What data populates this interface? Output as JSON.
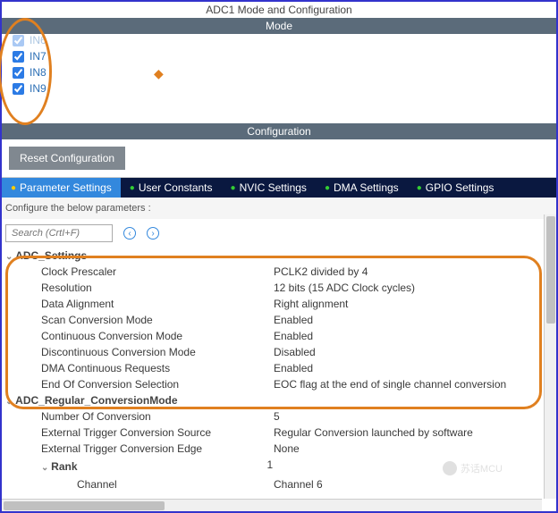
{
  "header": {
    "title": "ADC1 Mode and Configuration"
  },
  "mode": {
    "title": "Mode",
    "channels": [
      {
        "label": "IN6",
        "checked": true,
        "partial": true
      },
      {
        "label": "IN7",
        "checked": true
      },
      {
        "label": "IN8",
        "checked": true
      },
      {
        "label": "IN9",
        "checked": true
      }
    ]
  },
  "config": {
    "title": "Configuration",
    "reset_label": "Reset Configuration",
    "tabs": [
      {
        "label": "Parameter Settings",
        "active": true,
        "icon": "yellow"
      },
      {
        "label": "User Constants",
        "icon": "green"
      },
      {
        "label": "NVIC Settings",
        "icon": "green"
      },
      {
        "label": "DMA Settings",
        "icon": "green"
      },
      {
        "label": "GPIO Settings",
        "icon": "green"
      }
    ],
    "desc": "Configure the below parameters :",
    "search_placeholder": "Search (CrtI+F)"
  },
  "params": {
    "groups": [
      {
        "name": "ADC_Settings",
        "items": [
          {
            "label": "Clock Prescaler",
            "value": "PCLK2 divided by 4"
          },
          {
            "label": "Resolution",
            "value": "12 bits (15 ADC Clock cycles)"
          },
          {
            "label": "Data Alignment",
            "value": "Right alignment"
          },
          {
            "label": "Scan Conversion Mode",
            "value": "Enabled"
          },
          {
            "label": "Continuous Conversion Mode",
            "value": "Enabled"
          },
          {
            "label": "Discontinuous Conversion Mode",
            "value": "Disabled"
          },
          {
            "label": "DMA Continuous Requests",
            "value": "Enabled"
          },
          {
            "label": "End Of Conversion Selection",
            "value": "EOC flag at the end of single channel conversion"
          }
        ]
      },
      {
        "name": "ADC_Regular_ConversionMode",
        "items": [
          {
            "label": "Number Of Conversion",
            "value": "5"
          },
          {
            "label": "External Trigger Conversion Source",
            "value": "Regular Conversion launched by software"
          },
          {
            "label": "External Trigger Conversion Edge",
            "value": "None"
          }
        ],
        "sub": {
          "name": "Rank",
          "value": "1",
          "items": [
            {
              "label": "Channel",
              "value": "Channel 6"
            }
          ]
        }
      }
    ]
  },
  "watermark": "苏话MCU"
}
